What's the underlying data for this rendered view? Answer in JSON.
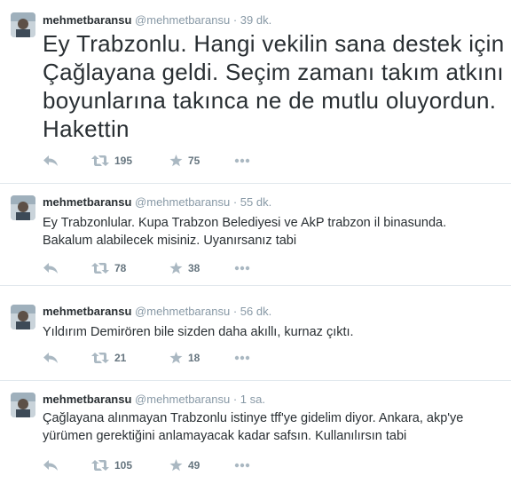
{
  "tweets": [
    {
      "fullname": "mehmetbaransu",
      "username": "@mehmetbaransu",
      "separator": "·",
      "time": "39 dk.",
      "text": "Ey Trabzonlu. Hangi vekilin sana destek için\nÇağlayana geldi. Seçim zamanı takım atkını\nboyunlarına takınca ne de mutlu oluyordun.\nHakettin",
      "retweets": "195",
      "favorites": "75"
    },
    {
      "fullname": "mehmetbaransu",
      "username": "@mehmetbaransu",
      "separator": "·",
      "time": "55 dk.",
      "text": "Ey Trabzonlular. Kupa Trabzon Belediyesi ve AkP trabzon il binasunda.\nBakalum alabilecek misiniz. Uyanırsanız tabi",
      "retweets": "78",
      "favorites": "38"
    },
    {
      "fullname": "mehmetbaransu",
      "username": "@mehmetbaransu",
      "separator": "·",
      "time": "56 dk.",
      "text": "Yıldırım Demirören bile sizden daha akıllı, kurnaz çıktı.",
      "retweets": "21",
      "favorites": "18"
    },
    {
      "fullname": "mehmetbaransu",
      "username": "@mehmetbaransu",
      "separator": "·",
      "time": "1 sa.",
      "text": "Çağlayana alınmayan Trabzonlu istinye tff'ye gidelim diyor. Ankara, akp'ye\nyürümen gerektiğini anlamayacak kadar safsın. Kullanılırsın tabi",
      "retweets": "105",
      "favorites": "49"
    }
  ],
  "icons": {
    "reply": "reply-icon",
    "retweet": "retweet-icon",
    "favorite": "star-icon",
    "more": "more-icon"
  },
  "colors": {
    "action_gray": "#aab8c2",
    "text": "#292f33",
    "secondary": "#8899a6",
    "divider": "#e1e8ed"
  }
}
